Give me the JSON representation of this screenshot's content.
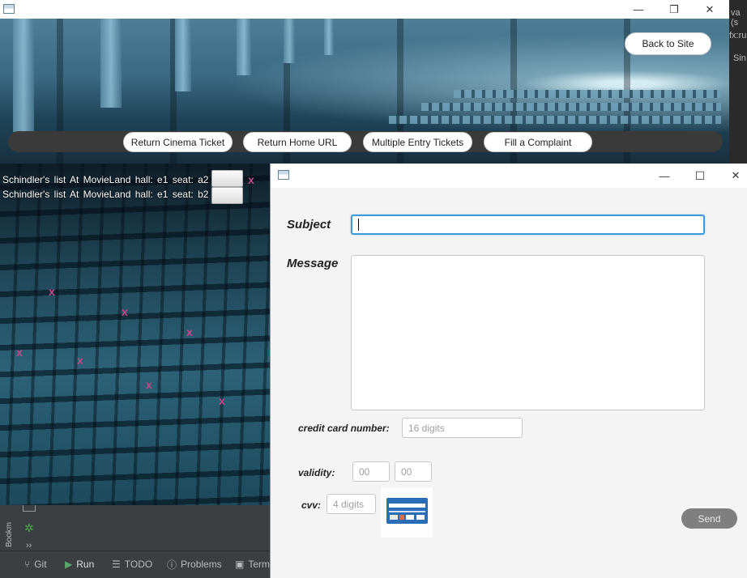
{
  "main_window": {
    "back_button": "Back to Site",
    "nav": {
      "return_ticket": "Return Cinema Ticket",
      "return_home": "Return Home URL",
      "multi_entry": "Multiple Entry Tickets",
      "complaint": "Fill a Complaint"
    },
    "tickets": [
      "Schindler's list  At  MovieLand  hall:  e1  seat:  a2",
      "Schindler's list  At  MovieLand  hall:  e1  seat:  b2"
    ],
    "controls": {
      "minimize": "—",
      "maximize": "❐",
      "close": "✕"
    }
  },
  "ide": {
    "tabs": [
      {
        "icon": "git-icon",
        "label": "Git"
      },
      {
        "icon": "run-icon",
        "label": "Run"
      },
      {
        "icon": "todo-icon",
        "label": "TODO"
      },
      {
        "icon": "problems-icon",
        "label": "Problems"
      },
      {
        "icon": "terminal-icon",
        "label": "Term"
      }
    ],
    "bookmarks_label": "Bookm",
    "right_edge_texts": [
      "va (s",
      "fx:ru",
      "Sin"
    ]
  },
  "complaint_window": {
    "controls": {
      "minimize": "—",
      "maximize": "☐",
      "close": "✕"
    },
    "subject_label": "Subject",
    "subject_value": "",
    "message_label": "Message",
    "message_value": "",
    "card_label": "credit card number:",
    "card_placeholder": "16 digits",
    "validity_label": "validity:",
    "validity_month_placeholder": "00",
    "validity_year_placeholder": "00",
    "cvv_label": "cvv:",
    "cvv_placeholder": "4 digits",
    "send_label": "Send"
  }
}
